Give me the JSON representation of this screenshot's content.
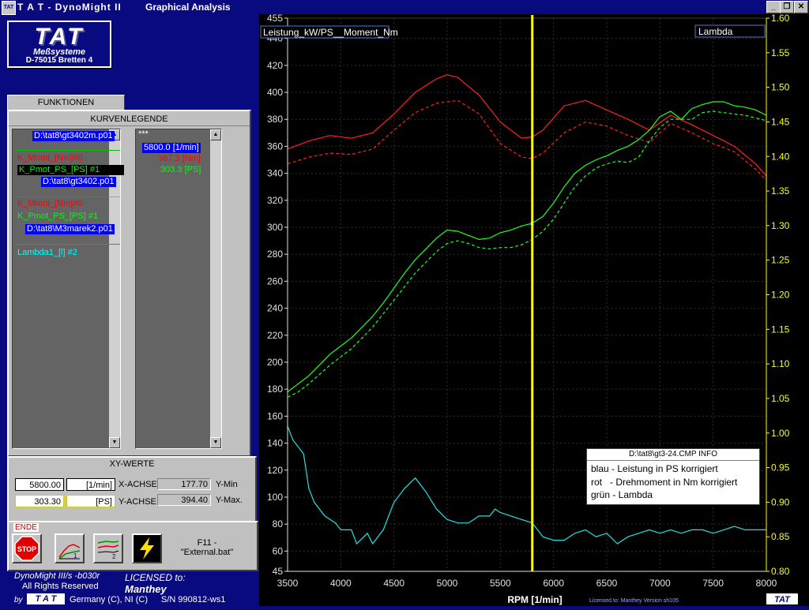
{
  "window": {
    "app_title": "T A T - DynoMight II",
    "mode_title": "Graphical Analysis",
    "icon_text": "TAT",
    "min_btn": "_",
    "restore_btn": "❐",
    "close_btn": "✕"
  },
  "logo": {
    "name": "TAT",
    "line1": "Meßsysteme",
    "line2": "D-75015 Bretten 4"
  },
  "funktionen_tab": "FUNKTIONEN",
  "legend": {
    "header": "KURVENLEGENDE",
    "items": [
      {
        "text": "D:\\tat8\\gt3402m.p01",
        "color": "#ffffff",
        "bg": "#0000ff"
      },
      {
        "text": "K_Mmot_[Nm]#0",
        "color": "#ff0000",
        "bg": ""
      },
      {
        "text": "K_Pmot_PS_[PS] #1",
        "color": "#00ff00",
        "bg": "#000000"
      },
      {
        "text": "D:\\tat8\\gt3402.p01",
        "color": "#ffffff",
        "bg": "#0000ff"
      },
      {
        "text": "K_Mmot_[Nm]#0",
        "color": "#ff0000",
        "bg": ""
      },
      {
        "text": "K_Pmot_PS_[PS] #1",
        "color": "#00ff00",
        "bg": ""
      },
      {
        "text": "D:\\tat8\\M3marek2.p01",
        "color": "#ffffff",
        "bg": "#0000ff"
      },
      {
        "text": "Lambda1_[l] #2",
        "color": "#00ffff",
        "bg": ""
      }
    ],
    "values_header": "***",
    "values": [
      {
        "text": "5800.0 [1/min]",
        "color": "#ffffff",
        "bg": "#0000ff"
      },
      {
        "text": "367.3 [Nm]",
        "color": "#ff0000",
        "bg": ""
      },
      {
        "text": "303.3 [PS]",
        "color": "#00ff00",
        "bg": ""
      }
    ]
  },
  "xy": {
    "header": "XY-WERTE",
    "x_value": "5800.00",
    "x_unit": "[1/min]",
    "x_label": "X-ACHSE",
    "y_value": "303.30",
    "y_unit": "[PS]",
    "y_label": "Y-ACHSE",
    "ymin_value": "177.70",
    "ymin_label": "Y-Min",
    "ymax_value": "394.40",
    "ymax_label": "Y-Max."
  },
  "toolbar": {
    "ende": "ENDE",
    "stop": "STOP",
    "btn1_num": "1",
    "btn2_num": "2",
    "f11_line1": "F11 -",
    "f11_line2": "\"External.bat\""
  },
  "footer": {
    "version": "DynoMight III/s -b030r",
    "rights": "All Rights Reserved",
    "licensed": "LICENSED to:",
    "licensee": "Manthey",
    "by": "by",
    "brand": "T A T",
    "country": "Germany (C), NI (C)",
    "serial": "S/N  990812-ws1"
  },
  "chart_labels": {
    "left_label": "Leistung_kW/PS__Moment_Nm",
    "right_label": "Lambda",
    "licensed_small": "Licensed to: Manthey   Version sh105",
    "tat_small": "TAT"
  },
  "info": {
    "title": "D:\\tat8\\gt3-24.CMP  INFO",
    "rows": [
      "blau - Leistung in PS korrigiert",
      "rot   - Drehmoment in Nm korrigiert",
      "grün - Lambda"
    ]
  },
  "chart_data": {
    "type": "line",
    "xlabel": "RPM  [1/min]",
    "ylabel": "Leistung_kW/PS__Moment_Nm",
    "y2label": "Lambda",
    "xlim": [
      3500,
      8000
    ],
    "ylim": [
      45,
      455
    ],
    "y2lim": [
      0.8,
      1.6
    ],
    "x_ticks": [
      3500,
      4000,
      4500,
      5000,
      5500,
      6000,
      6500,
      7000,
      7500,
      8000
    ],
    "y_ticks": [
      45,
      60,
      80,
      100,
      120,
      140,
      160,
      180,
      200,
      220,
      240,
      260,
      280,
      300,
      320,
      340,
      360,
      380,
      400,
      420,
      440,
      455
    ],
    "y2_ticks": [
      "0.80",
      "0.85",
      "0.90",
      "0.95",
      "1.00",
      "1.05",
      "1.10",
      "1.15",
      "1.20",
      "1.25",
      "1.30",
      "1.35",
      "1.40",
      "1.45",
      "1.50",
      "1.55",
      "1.60"
    ],
    "cursor_x": 5800,
    "grid": true,
    "series": [
      {
        "name": "K_Mmot_[Nm]#0",
        "axis": "left",
        "color": "#ff2020",
        "dash": false,
        "x": [
          3500,
          3700,
          3900,
          4100,
          4300,
          4500,
          4700,
          4900,
          5000,
          5100,
          5300,
          5500,
          5700,
          5800,
          5900,
          6100,
          6300,
          6500,
          6700,
          6900,
          7100,
          7300,
          7500,
          7700,
          7900,
          8000
        ],
        "y": [
          358,
          364,
          368,
          366,
          370,
          384,
          400,
          410,
          413,
          411,
          398,
          378,
          366,
          367,
          372,
          390,
          394,
          387,
          380,
          372,
          383,
          376,
          368,
          360,
          347,
          338
        ]
      },
      {
        "name": "K_Mmot_[Nm]#0",
        "axis": "left",
        "color": "#ff2020",
        "dash": true,
        "x": [
          3500,
          3700,
          3900,
          4100,
          4300,
          4500,
          4700,
          4900,
          5100,
          5300,
          5500,
          5700,
          5800,
          5900,
          6100,
          6300,
          6500,
          6700,
          6900,
          7100,
          7300,
          7500,
          7700,
          7900,
          8000
        ],
        "y": [
          347,
          352,
          355,
          354,
          358,
          372,
          385,
          392,
          394,
          384,
          362,
          352,
          351,
          355,
          370,
          378,
          375,
          368,
          363,
          377,
          370,
          362,
          356,
          343,
          335
        ]
      },
      {
        "name": "K_Pmot_PS_[PS] #1",
        "axis": "left",
        "color": "#20ff20",
        "dash": false,
        "x": [
          3500,
          3600,
          3700,
          3800,
          3900,
          4000,
          4100,
          4200,
          4300,
          4400,
          4500,
          4600,
          4700,
          4800,
          4900,
          5000,
          5100,
          5200,
          5300,
          5400,
          5500,
          5600,
          5700,
          5800,
          5900,
          6000,
          6100,
          6200,
          6300,
          6400,
          6500,
          6600,
          6700,
          6800,
          6900,
          7000,
          7100,
          7200,
          7300,
          7400,
          7500,
          7600,
          7700,
          7800,
          7900,
          8000
        ],
        "y": [
          178,
          184,
          190,
          198,
          206,
          212,
          218,
          226,
          234,
          244,
          255,
          266,
          276,
          284,
          292,
          298,
          297,
          294,
          291,
          292,
          296,
          298,
          301,
          303,
          308,
          318,
          330,
          340,
          346,
          350,
          353,
          357,
          360,
          365,
          372,
          382,
          386,
          380,
          388,
          391,
          393,
          393,
          390,
          389,
          387,
          383
        ]
      },
      {
        "name": "K_Pmot_PS_[PS] #1",
        "axis": "left",
        "color": "#20ff20",
        "dash": true,
        "x": [
          3500,
          3600,
          3700,
          3800,
          3900,
          4000,
          4100,
          4200,
          4300,
          4400,
          4500,
          4600,
          4700,
          4800,
          4900,
          5000,
          5100,
          5200,
          5300,
          5400,
          5500,
          5600,
          5700,
          5800,
          5900,
          6000,
          6100,
          6200,
          6300,
          6400,
          6500,
          6600,
          6700,
          6800,
          6900,
          7000,
          7100,
          7200,
          7300,
          7400,
          7500,
          7600,
          7700,
          7800,
          7900,
          8000
        ],
        "y": [
          174,
          178,
          184,
          191,
          198,
          204,
          210,
          218,
          226,
          236,
          246,
          256,
          266,
          274,
          282,
          288,
          290,
          288,
          285,
          284,
          285,
          285,
          287,
          291,
          297,
          306,
          318,
          330,
          338,
          344,
          347,
          349,
          348,
          352,
          364,
          374,
          380,
          380,
          380,
          385,
          386,
          385,
          384,
          383,
          381,
          379
        ]
      },
      {
        "name": "Lambda1_[l] #2",
        "axis": "right",
        "color": "#20e0e0",
        "dash": false,
        "x": [
          3500,
          3550,
          3650,
          3700,
          3750,
          3850,
          3950,
          4000,
          4100,
          4150,
          4250,
          4300,
          4400,
          4450,
          4500,
          4600,
          4700,
          4750,
          4800,
          4900,
          5000,
          5100,
          5200,
          5300,
          5400,
          5450,
          5500,
          5600,
          5700,
          5800,
          5850,
          5900,
          6000,
          6100,
          6200,
          6300,
          6400,
          6500,
          6600,
          6700,
          6800,
          6900,
          7000,
          7100,
          7200,
          7300,
          7400,
          7500,
          7600,
          7700,
          7800,
          7900,
          8000
        ],
        "y": [
          1.01,
          0.99,
          0.97,
          0.92,
          0.9,
          0.88,
          0.87,
          0.86,
          0.86,
          0.84,
          0.855,
          0.84,
          0.86,
          0.88,
          0.9,
          0.92,
          0.935,
          0.925,
          0.915,
          0.89,
          0.875,
          0.87,
          0.87,
          0.88,
          0.88,
          0.89,
          0.885,
          0.88,
          0.875,
          0.87,
          0.86,
          0.85,
          0.845,
          0.845,
          0.855,
          0.86,
          0.85,
          0.855,
          0.84,
          0.85,
          0.855,
          0.86,
          0.855,
          0.86,
          0.855,
          0.86,
          0.86,
          0.855,
          0.86,
          0.865,
          0.86,
          0.86,
          0.86
        ]
      }
    ]
  }
}
